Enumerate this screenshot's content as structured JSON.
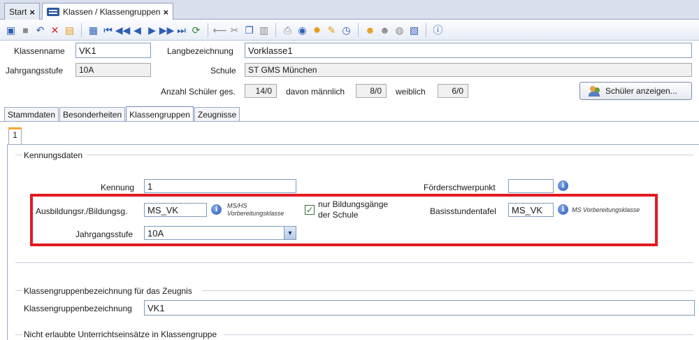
{
  "doc_tabs": [
    {
      "label": "Start"
    },
    {
      "label": "Klassen / Klassengruppen"
    }
  ],
  "close_glyph": "×",
  "toolbar_icons": [
    "new-icon",
    "save-icon",
    "undo-icon",
    "delete-icon",
    "report-icon",
    "copy-record-icon",
    "first-icon",
    "previous-fast-icon",
    "previous-icon",
    "next-icon",
    "next-fast-icon",
    "last-icon",
    "refresh-icon",
    "back-icon",
    "cut-icon",
    "copy-icon",
    "paste-icon",
    "print-icon",
    "preview-icon",
    "hint-icon",
    "clean-icon",
    "clock-icon",
    "users-icon",
    "user-icon",
    "coin-icon",
    "edit-icon",
    "help-icon"
  ],
  "header": {
    "klassenname_label": "Klassenname",
    "klassenname_value": "VK1",
    "langbezeichnung_label": "Langbezeichnung",
    "langbezeichnung_value": "Vorklasse1",
    "jahrgangsstufe_label": "Jahrgangsstufe",
    "jahrgangsstufe_value": "10A",
    "schule_label": "Schule",
    "schule_value": "ST GMS München",
    "anzahl_label": "Anzahl Schüler ges.",
    "anzahl_value": "14/0",
    "maennlich_label": "davon männlich",
    "maennlich_value": "8/0",
    "weiblich_label": "weiblich",
    "weiblich_value": "6/0",
    "schueler_button": "Schüler anzeigen..."
  },
  "tabs": [
    {
      "label": "Stammdaten"
    },
    {
      "label": "Besonderheiten"
    },
    {
      "label": "Klassengruppen"
    },
    {
      "label": "Zeugnisse"
    }
  ],
  "subtab_label": "1",
  "kennungsdaten": {
    "title": "Kennungsdaten",
    "kennung_label": "Kennung",
    "kennung_value": "1",
    "foerder_label": "Förderschwerpunkt",
    "foerder_value": "",
    "ausbildung_label": "Ausbildungsr./Bildungsg.",
    "ausbildung_value": "MS_VK",
    "ausbildung_hint_line1": "MS/HS",
    "ausbildung_hint_line2": "Vorbereitungsklasse",
    "nur_bildung_line1": "nur Bildungsgänge",
    "nur_bildung_line2": "der Schule",
    "nur_bildung_checked": true,
    "basis_label": "Basisstundentafel",
    "basis_value": "MS_VK",
    "basis_hint": "MS Vorbereitungsklasse",
    "jahrgang_label": "Jahrgangsstufe",
    "jahrgang_value": "10A"
  },
  "zeugnis": {
    "title": "Klassengruppenbezeichnung für das Zeugnis",
    "label": "Klassengruppenbezeichnung",
    "value": "VK1"
  },
  "nicht_erlaubt": {
    "title": "Nicht erlaubte Unterrichtseinsätze in Klassengruppe"
  },
  "highlight_color": "#e01b24"
}
